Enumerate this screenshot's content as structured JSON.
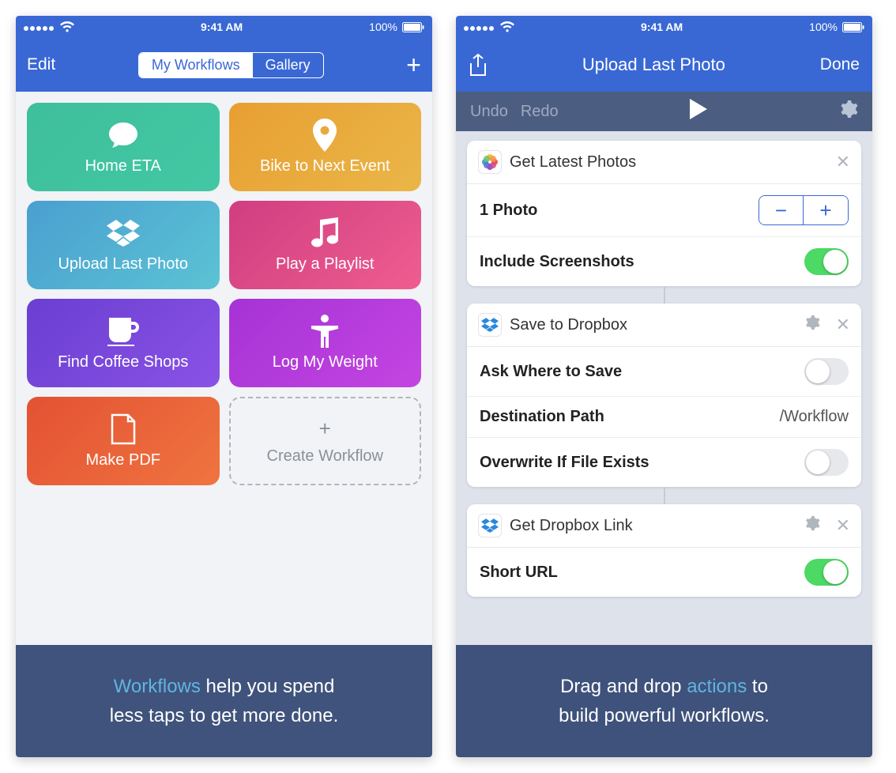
{
  "status": {
    "time": "9:41 AM",
    "battery": "100%"
  },
  "phone1": {
    "nav": {
      "left": "Edit",
      "seg_active": "My Workflows",
      "seg_inactive": "Gallery"
    },
    "cards": [
      {
        "label": "Home ETA"
      },
      {
        "label": "Bike to Next Event"
      },
      {
        "label": "Upload Last Photo"
      },
      {
        "label": "Play a Playlist"
      },
      {
        "label": "Find Coffee Shops"
      },
      {
        "label": "Log My Weight"
      },
      {
        "label": "Make PDF"
      },
      {
        "label": "Create Workflow"
      }
    ],
    "promo": {
      "hl": "Workflows",
      "text1": " help you spend",
      "text2": "less taps to get more done."
    }
  },
  "phone2": {
    "nav": {
      "title": "Upload Last Photo",
      "right": "Done"
    },
    "toolbar": {
      "undo": "Undo",
      "redo": "Redo"
    },
    "actions": [
      {
        "title": "Get Latest Photos",
        "rows": {
          "count": {
            "label": "1 Photo"
          },
          "screenshots": {
            "label": "Include Screenshots",
            "on": true
          }
        }
      },
      {
        "title": "Save to Dropbox",
        "rows": {
          "ask": {
            "label": "Ask Where to Save",
            "on": false
          },
          "dest": {
            "label": "Destination Path",
            "value": "/Workflow"
          },
          "overwrite": {
            "label": "Overwrite If File Exists",
            "on": false
          }
        }
      },
      {
        "title": "Get Dropbox Link",
        "rows": {
          "short": {
            "label": "Short URL",
            "on": true
          }
        }
      }
    ],
    "promo": {
      "text1": "Drag and drop ",
      "hl": "actions",
      "text2": " to",
      "text3": "build powerful workflows."
    }
  }
}
